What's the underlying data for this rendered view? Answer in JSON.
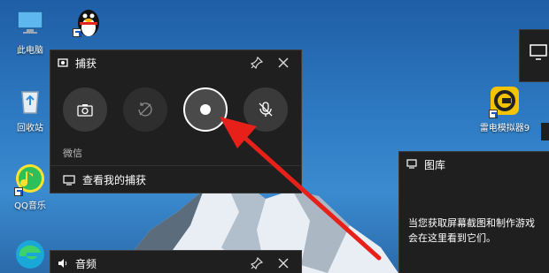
{
  "desktop": {
    "icons": [
      {
        "label": "此电脑",
        "icon": "computer-icon"
      },
      {
        "label": "腾讯QQ",
        "icon": "qq-penguin-icon"
      },
      {
        "label": "回收站",
        "icon": "recycle-bin-icon"
      },
      {
        "label": "QQ音乐",
        "icon": "qq-music-icon"
      },
      {
        "label": "雷电模拟器9",
        "icon": "ldplayer-icon"
      }
    ]
  },
  "capture_panel": {
    "title": "捕获",
    "app_name": "微信",
    "view_captures_label": "查看我的捕获",
    "buttons": [
      "screenshot-button",
      "record-last-30s-button",
      "start-recording-button",
      "mic-toggle-button"
    ]
  },
  "audio_panel": {
    "title": "音频"
  },
  "gallery_panel": {
    "title": "图库",
    "text_line1": "当您获取屏幕截图和制作游戏",
    "text_line2": "会在这里看到它们。"
  },
  "colors": {
    "panel_bg": "#1f1f1f",
    "arrow": "#e8201a"
  }
}
